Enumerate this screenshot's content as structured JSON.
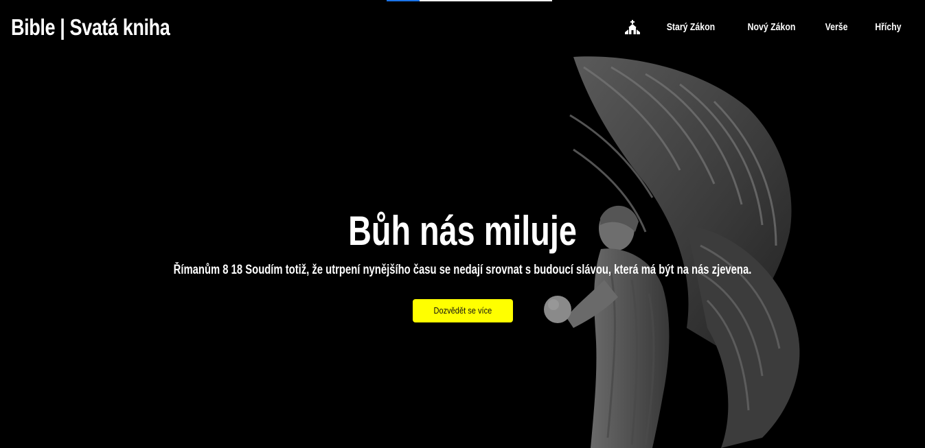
{
  "page": {
    "brand": "Bible | Svatá kniha",
    "progress": 0.2
  },
  "nav": {
    "home_icon": "church-icon",
    "items": [
      {
        "label": "Starý Zákon"
      },
      {
        "label": "Nový Zákon"
      },
      {
        "label": "Verše"
      },
      {
        "label": "Hříchy"
      }
    ]
  },
  "hero": {
    "title": "Bůh nás miluje",
    "verse": "Římanům 8 18 Soudím totiž, že utrpení nynějšího času se nedají srovnat s budoucí slávou, která má být na nás zjevena.",
    "cta_label": "Dozvědět se více",
    "image": "angel-statue-image"
  },
  "colors": {
    "background": "#000000",
    "text": "#ffffff",
    "accent": "#ffff00",
    "progress": "#1a73e8"
  }
}
